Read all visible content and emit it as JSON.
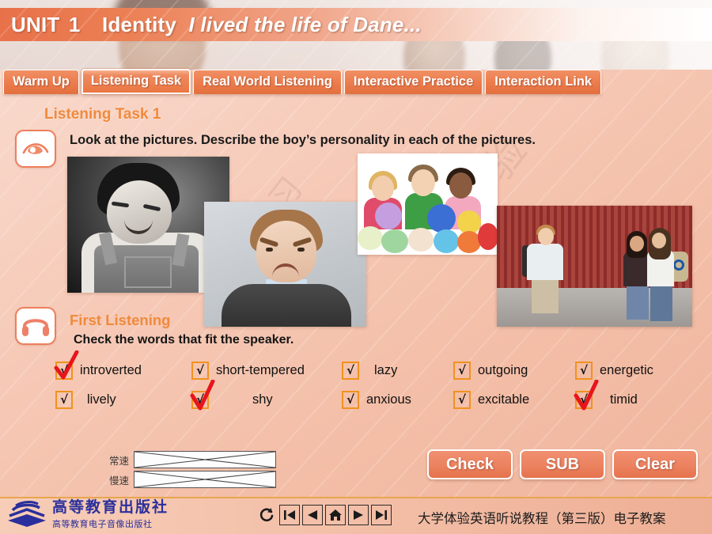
{
  "header": {
    "unit_label": "UNIT",
    "unit_number": "1",
    "identity": "Identity",
    "subtitle": "I lived the life of Dane...",
    "accent_color": "#e8714a"
  },
  "tabs": [
    {
      "label": "Warm Up",
      "active": false
    },
    {
      "label": "Listening Task",
      "active": true
    },
    {
      "label": "Real World Listening",
      "active": false
    },
    {
      "label": "Interactive Practice",
      "active": false
    },
    {
      "label": "Interaction Link",
      "active": false
    }
  ],
  "task": {
    "heading": "Listening Task 1",
    "eye_icon": "eye-icon",
    "instruction": "Look at the pictures. Describe the boy’s personality in each of the pictures."
  },
  "photos": [
    {
      "name": "photo-boy-smiling-bw",
      "alt": "black and white boy in overalls looking down smiling"
    },
    {
      "name": "photo-boy-angry",
      "alt": "boy with angry scrunched face in dark sweater"
    },
    {
      "name": "photo-kids-balloons",
      "alt": "three children playing with colorful balloons"
    },
    {
      "name": "photo-teens-school",
      "alt": "teen boy with backpack and two girls by red wall"
    }
  ],
  "first_listening": {
    "headphone_icon": "headphone-icon",
    "title": "First Listening",
    "instruction": "Check the words that fit the speaker.",
    "checkbox_mark": "√",
    "box_color": "#f0921f",
    "tick_color": "#e8141c",
    "rows": [
      [
        {
          "label": "introverted",
          "checked": true
        },
        {
          "label": "short-tempered",
          "checked": false
        },
        {
          "label": "lazy",
          "checked": false
        },
        {
          "label": "outgoing",
          "checked": false
        },
        {
          "label": "energetic",
          "checked": false
        }
      ],
      [
        {
          "label": "lively",
          "checked": false
        },
        {
          "label": "shy",
          "checked": true
        },
        {
          "label": "anxious",
          "checked": false
        },
        {
          "label": "excitable",
          "checked": false
        },
        {
          "label": "timid",
          "checked": true
        }
      ]
    ]
  },
  "audio": {
    "tracks": [
      {
        "label": "常速"
      },
      {
        "label": "慢速"
      }
    ]
  },
  "actions": [
    {
      "label": "Check",
      "name": "check-button"
    },
    {
      "label": "SUB",
      "name": "sub-button"
    },
    {
      "label": "Clear",
      "name": "clear-button"
    }
  ],
  "footer": {
    "publisher_name": "高等教育出版社",
    "publisher_sub": "高等教育电子音像出版社",
    "nav": [
      {
        "name": "refresh-icon",
        "glyph": "↺"
      },
      {
        "name": "first-page-icon",
        "glyph": "|◀"
      },
      {
        "name": "previous-page-icon",
        "glyph": "◀"
      },
      {
        "name": "home-icon",
        "glyph": "⌂"
      },
      {
        "name": "next-page-icon",
        "glyph": "▶"
      },
      {
        "name": "last-page-icon",
        "glyph": "▶|"
      }
    ],
    "course_title": "大学体验英语听说教程（第三版）电子教案"
  }
}
